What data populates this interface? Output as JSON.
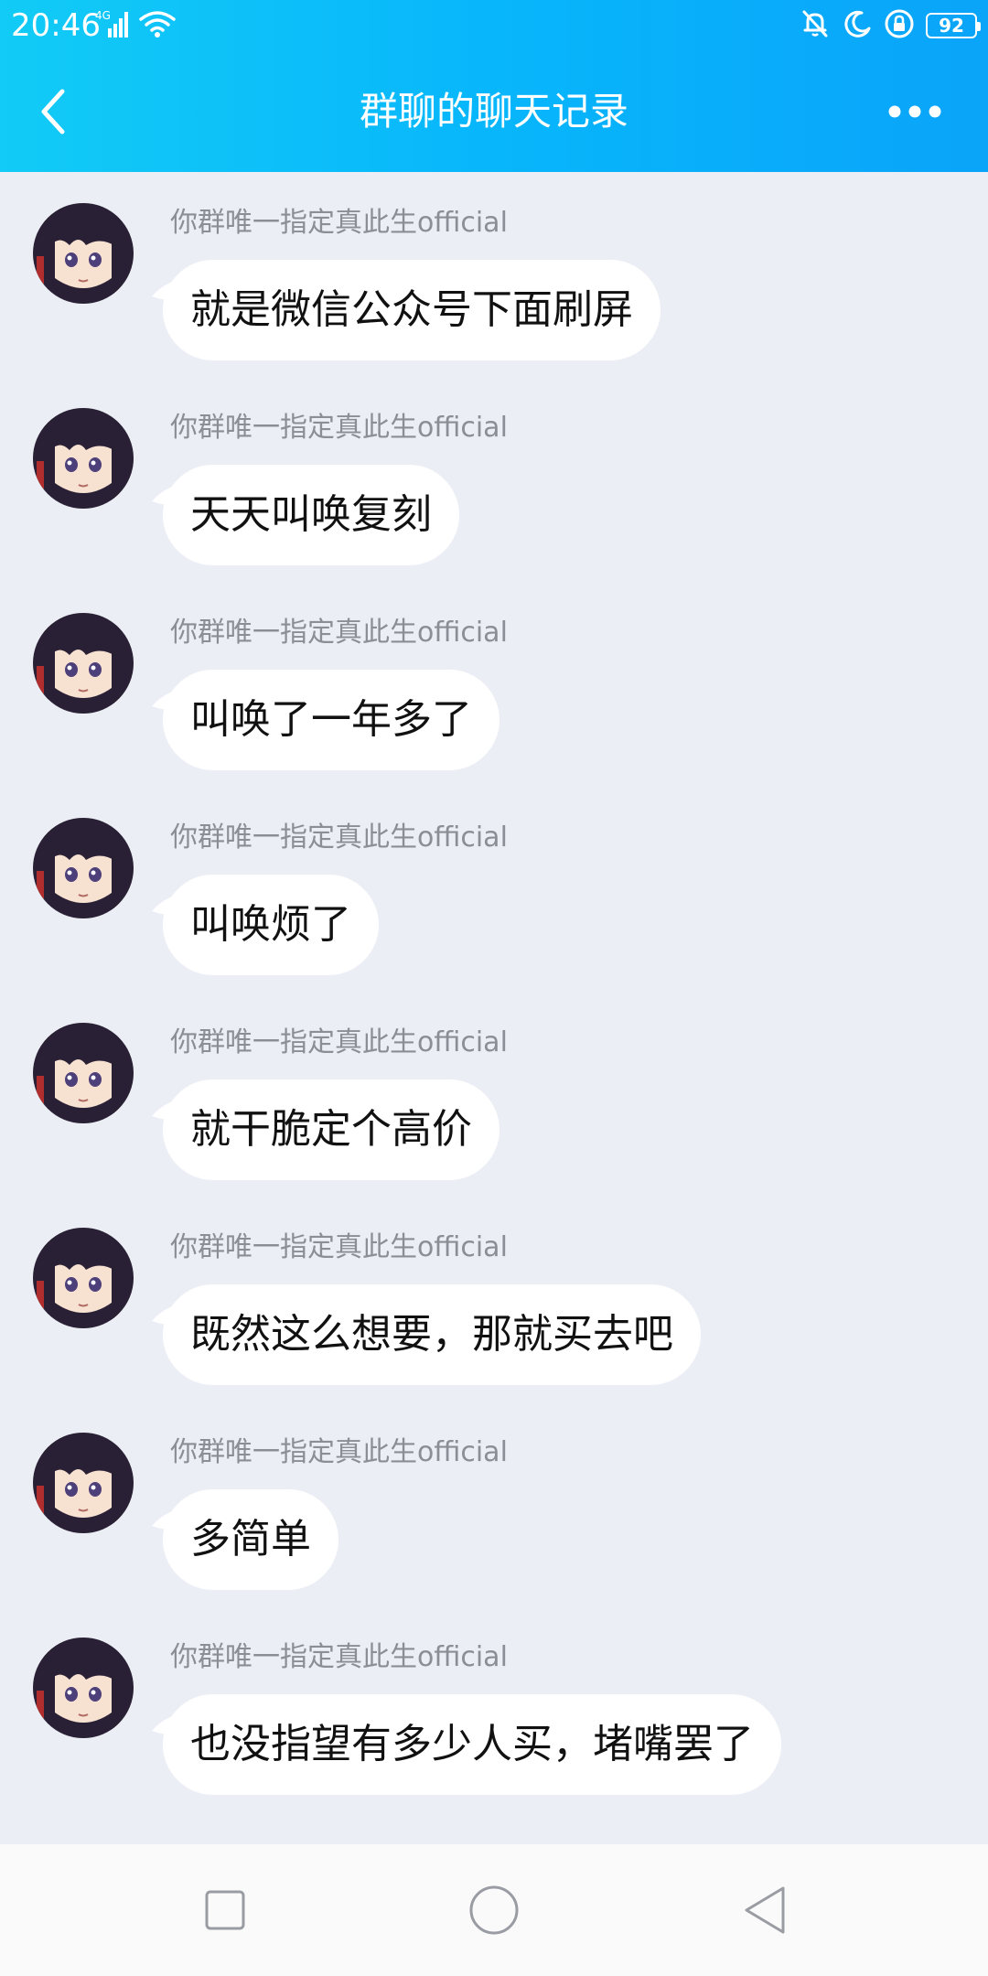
{
  "status_bar": {
    "time": "20:46",
    "network": "4G",
    "battery": "92"
  },
  "nav": {
    "title": "群聊的聊天记录"
  },
  "messages": [
    {
      "sender": "你群唯一指定真此生official",
      "text": "就是微信公众号下面刷屏"
    },
    {
      "sender": "你群唯一指定真此生official",
      "text": "天天叫唤复刻"
    },
    {
      "sender": "你群唯一指定真此生official",
      "text": "叫唤了一年多了"
    },
    {
      "sender": "你群唯一指定真此生official",
      "text": "叫唤烦了"
    },
    {
      "sender": "你群唯一指定真此生official",
      "text": "就干脆定个高价"
    },
    {
      "sender": "你群唯一指定真此生official",
      "text": "既然这么想要，那就买去吧"
    },
    {
      "sender": "你群唯一指定真此生official",
      "text": "多简单"
    },
    {
      "sender": "你群唯一指定真此生official",
      "text": "也没指望有多少人买，堵嘴罢了"
    }
  ],
  "colors": {
    "header_start": "#12cbf6",
    "header_end": "#0aa4f9",
    "chat_background": "#eceef5",
    "bubble": "#ffffff",
    "sender_text": "#8b8e96"
  }
}
